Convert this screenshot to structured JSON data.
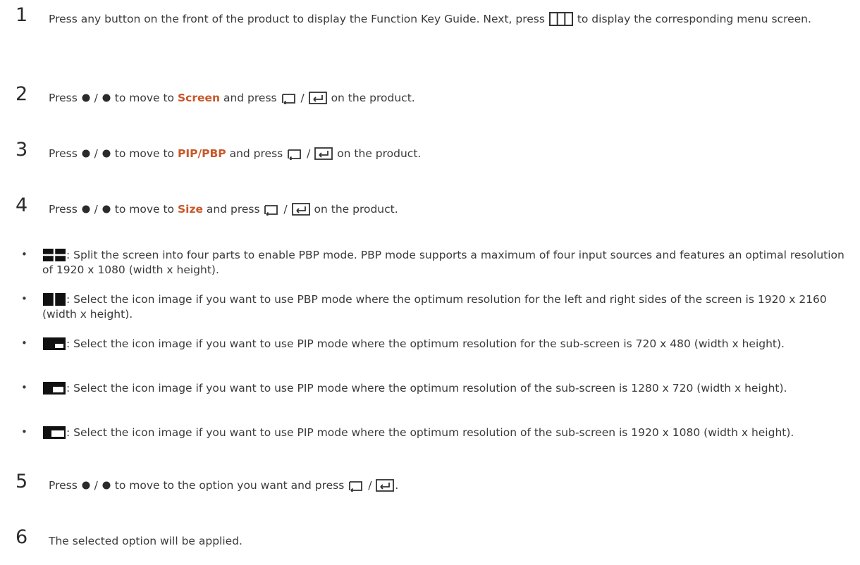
{
  "steps": [
    {
      "num": "1",
      "part1": "Press any button on the front of the product to display the Function Key Guide. Next, press ",
      "part2": " to display the corresponding menu screen."
    },
    {
      "num": "2",
      "pre": "Press ",
      "sep": "/",
      "mid": " to move to ",
      "hl": "Screen",
      "post": " and press ",
      "tail": " on the product."
    },
    {
      "num": "3",
      "pre": "Press ",
      "sep": "/",
      "mid": " to move to ",
      "hl": "PIP/PBP",
      "post": " and press ",
      "tail": " on the product."
    },
    {
      "num": "4",
      "pre": "Press ",
      "sep": "/",
      "mid": " to move to ",
      "hl": "Size",
      "post": " and press ",
      "tail": " on the product."
    },
    {
      "num": "5",
      "pre": "Press ",
      "sep": "/",
      "mid": " to move to the option you want and press ",
      "tail": "."
    },
    {
      "num": "6",
      "text": "The selected option will be applied."
    }
  ],
  "bullets": [
    {
      "icon": "four-split-icon",
      "text": ": Split the screen into four parts to enable PBP mode. PBP mode supports a maximum of four input sources and features an optimal resolution of 1920 x 1080 (width x height)."
    },
    {
      "icon": "two-split-icon",
      "text": ": Select the icon image if you want to use PBP mode where the optimum resolution for the left and right sides of the screen is 1920 x 2160 (width x height)."
    },
    {
      "icon": "pip-small-icon",
      "text": ": Select the icon image if you want to use PIP mode where the optimum resolution for the sub-screen is 720 x 480 (width x height)."
    },
    {
      "icon": "pip-medium-icon",
      "text": ": Select the icon image if you want to use PIP mode where the optimum resolution of the sub-screen is 1280 x 720 (width x height)."
    },
    {
      "icon": "pip-large-icon",
      "text": ": Select the icon image if you want to use PIP mode where the optimum resolution of the sub-screen is 1920 x 1080 (width x height)."
    }
  ],
  "bullet_char": "•"
}
